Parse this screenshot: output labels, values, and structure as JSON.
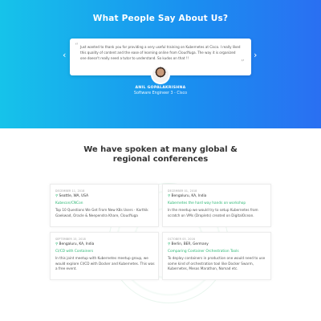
{
  "testimonials": {
    "heading": "What People Say About Us?",
    "quote": "Just wanted to thank you for providing a very useful training on Kubernetes at Cisco. I really liked this quality of content and the ease of learning online from CloudYuga. The way it is organized one doesn't really need a tutor to understand. So kudos on that !!",
    "author_name": "ANIL GOPALAKRISHNA",
    "author_role": "Software Engineer 3 - Cisco",
    "prev_icon": "chevron-left-icon",
    "next_icon": "chevron-right-icon"
  },
  "conferences": {
    "heading": "We have spoken at many global & regional conferences",
    "accent_color": "#2bb673",
    "items": [
      {
        "date": "DECEMBER 11, 2018",
        "location": "Seattle, WA, USA",
        "event": "Kubecon/CNCon",
        "description": "Top 10 Questions We Get From New K8s Users - Karthik Gaekwad, Oracle & Neependra Khare, CloudYuga"
      },
      {
        "date": "DECEMBER 01, 2018",
        "location": "Bengaluru, KA, India",
        "event": "Kubernetes the hard way hands on workshop",
        "description": "In the meetup we would try to setup Kubernetes from scratch on VMs (Droplets) created on DigitalOcean."
      },
      {
        "date": "SEPTEMBER 15, 2018",
        "location": "Bengaluru, KA, India",
        "event": "CI/CD with Containers",
        "description": "In this joint meetup with Kubernetes meetup group, we would explore CI/CD with Docker and Kubernetes. This was a free event."
      },
      {
        "date": "OCTOBER 05, 2016",
        "location": "Berlin, BER, Germany",
        "event": "Comparing Container Orchestration Tools",
        "description": "To deploy containers in production one would need to use some kind of orchestration tool like Docker Swarm, Kubernetes, Mesos Marathon, Nomad etc."
      }
    ]
  }
}
